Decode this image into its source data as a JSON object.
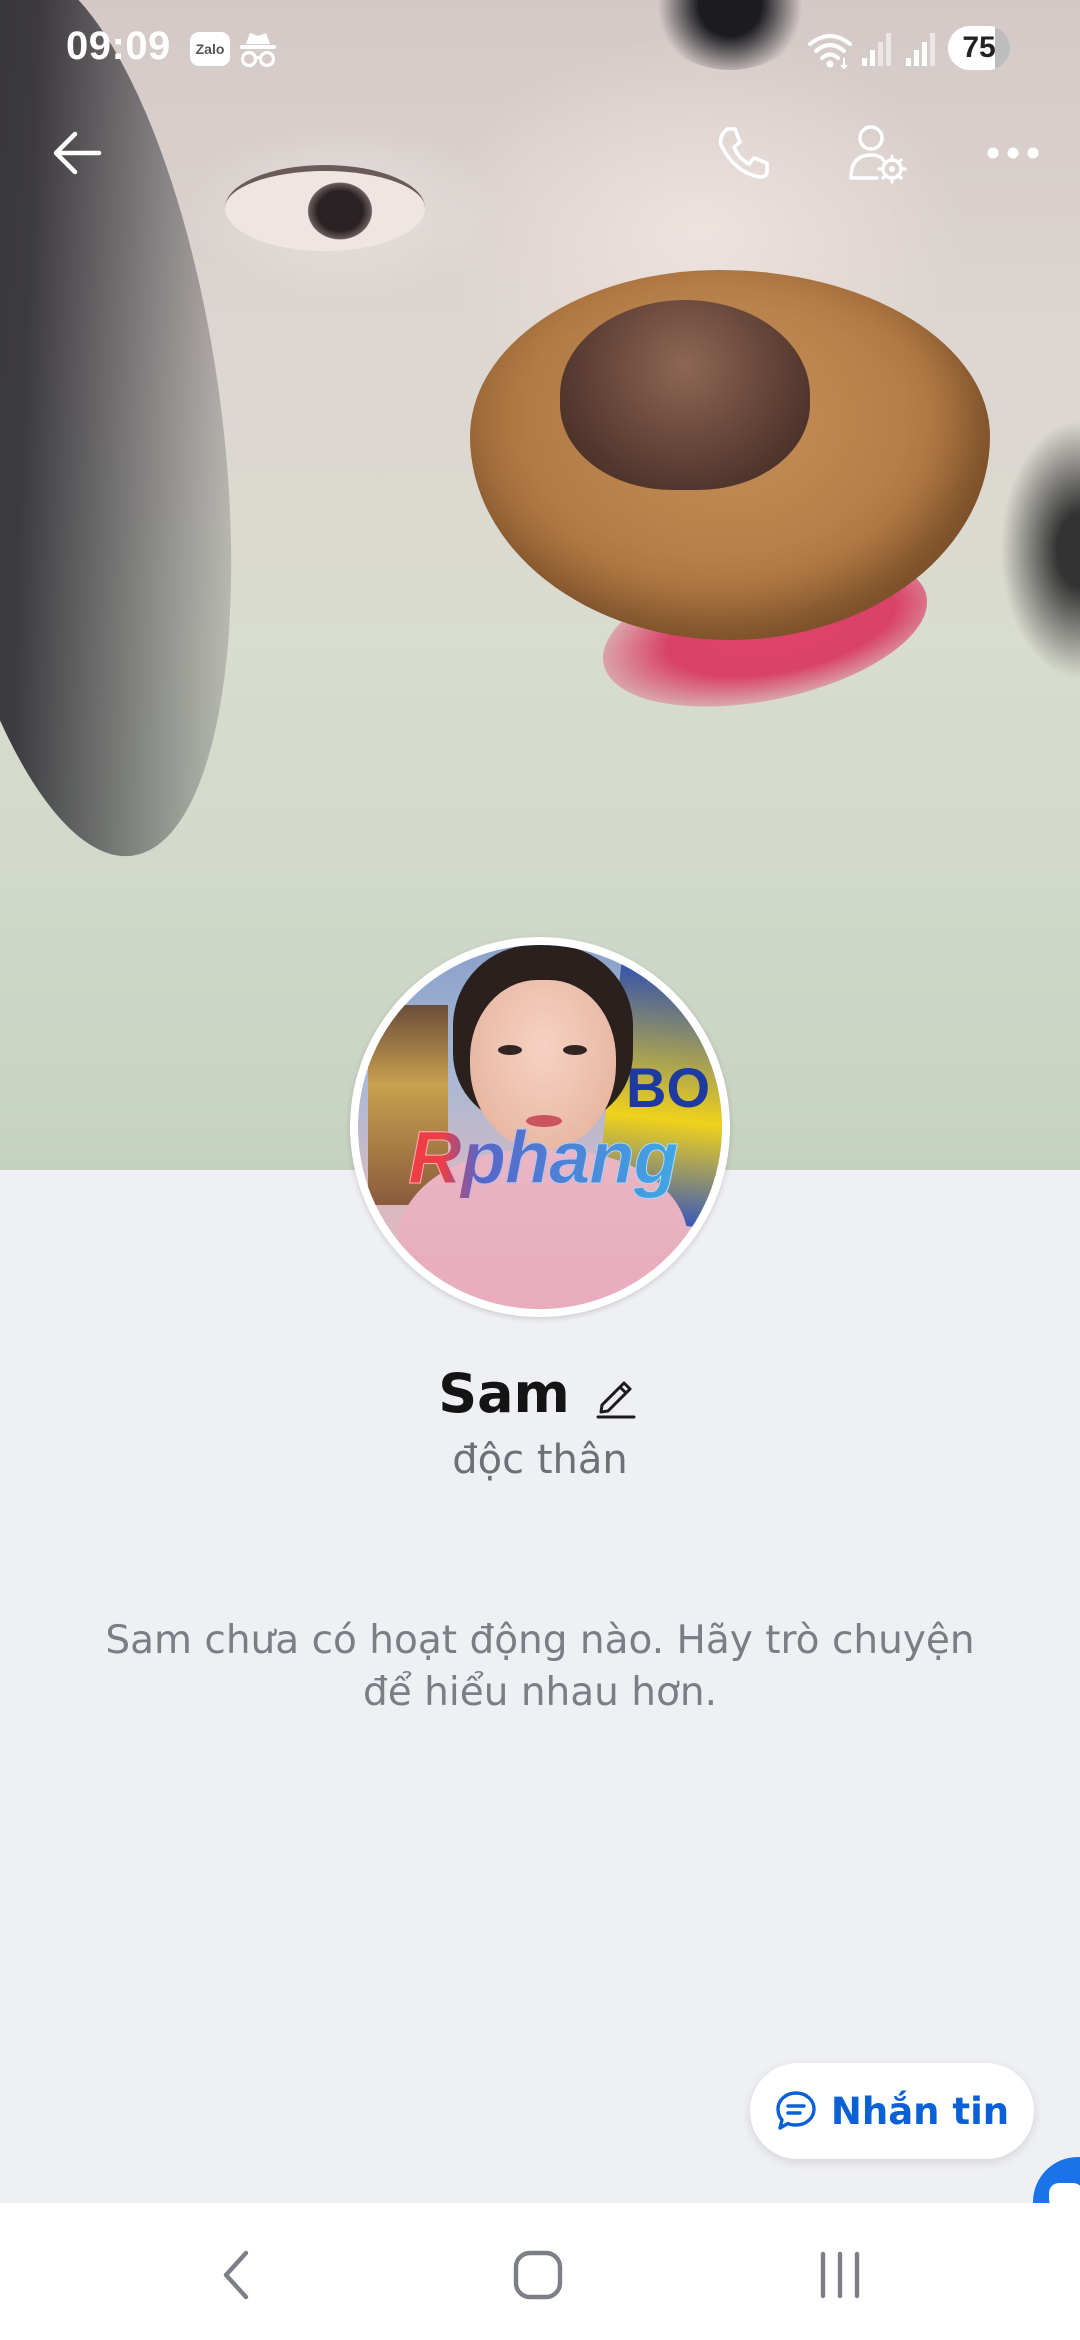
{
  "status_bar": {
    "time": "09:09",
    "notification_icons": [
      "zalo-icon",
      "incognito-icon"
    ],
    "zalo_label": "Zalo",
    "system_icons": [
      "wifi-icon",
      "signal-icon",
      "signal-icon"
    ],
    "battery_level": "75"
  },
  "top_bar": {
    "icons": [
      "back-arrow-icon",
      "phone-icon",
      "user-settings-icon",
      "more-options-icon"
    ]
  },
  "avatar": {
    "watermark": "Rphang",
    "sign_text": "BO"
  },
  "profile": {
    "name": "Sam",
    "status": "độc thân",
    "empty_activity_message": "Sam chưa có hoạt động nào. Hãy trò chuyện để hiểu nhau hơn."
  },
  "message_button": {
    "label": "Nhắn tin",
    "icon": "chat-icon",
    "color": "#0a61d6"
  },
  "nav_bar": {
    "icons": [
      "nav-back-icon",
      "nav-home-icon",
      "nav-recents-icon"
    ]
  },
  "colors": {
    "background": "#eff0f4",
    "accent": "#0a61d6",
    "text_primary": "#141414",
    "text_secondary": "#6d7177"
  }
}
